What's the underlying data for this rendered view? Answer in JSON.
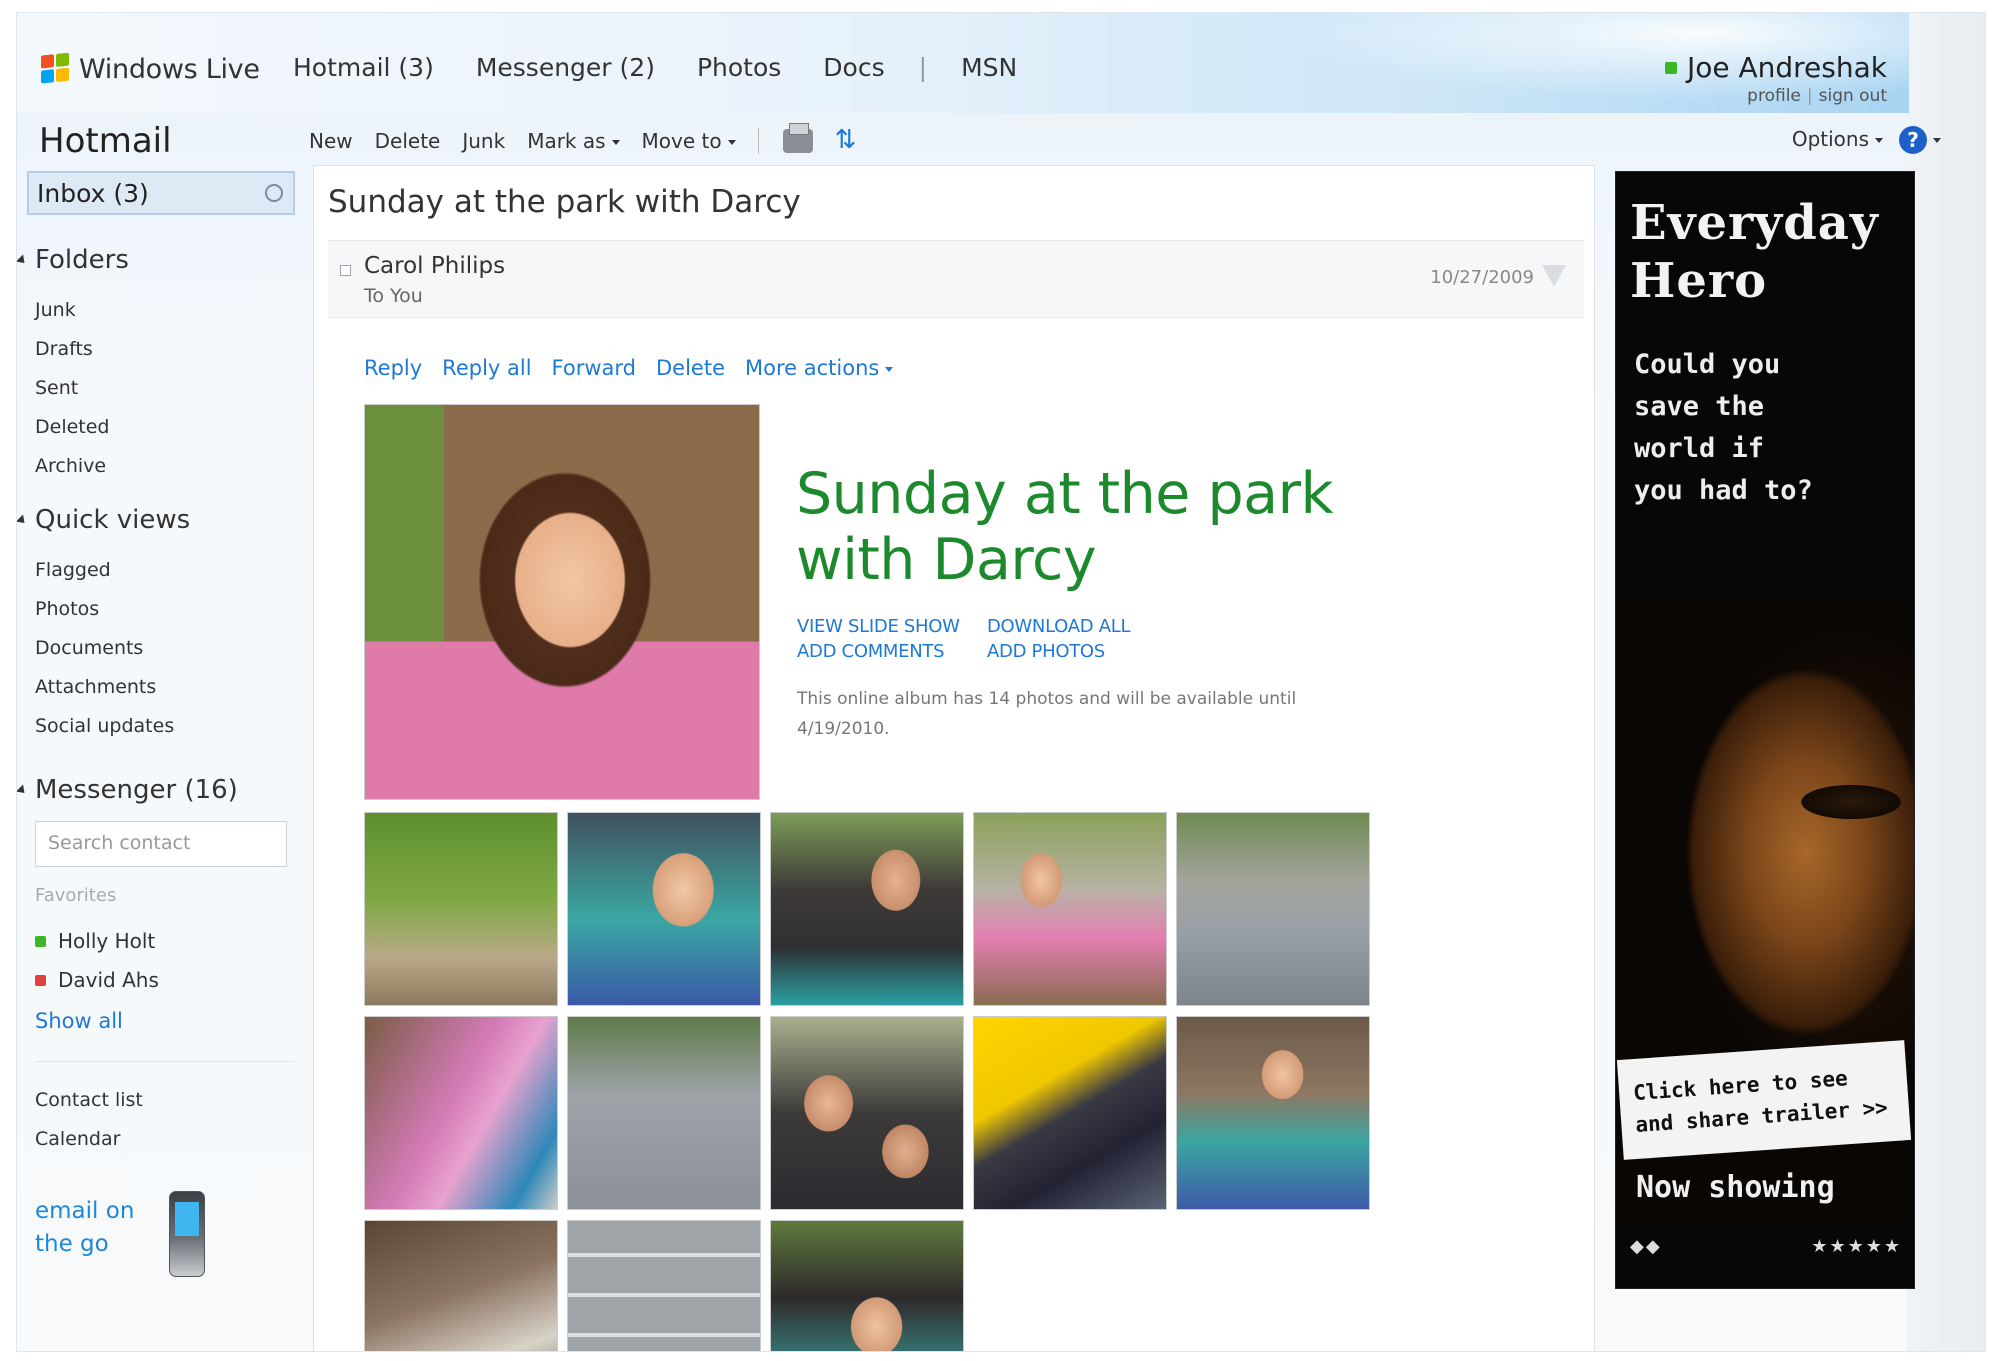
{
  "topbar": {
    "brand": "Windows Live",
    "nav": [
      "Hotmail (3)",
      "Messenger (2)",
      "Photos",
      "Docs",
      "|",
      "MSN"
    ],
    "user_name": "Joe Andreshak",
    "profile_link": "profile",
    "link_separator": "|",
    "signout_link": "sign out"
  },
  "sidebar": {
    "title": "Hotmail",
    "inbox": "Inbox (3)",
    "folders_heading": "Folders",
    "folders": [
      "Junk",
      "Drafts",
      "Sent",
      "Deleted",
      "Archive"
    ],
    "quickviews_heading": "Quick views",
    "quickviews": [
      "Flagged",
      "Photos",
      "Documents",
      "Attachments",
      "Social updates"
    ],
    "messenger_heading": "Messenger (16)",
    "search_placeholder": "Search contact",
    "favorites_label": "Favorites",
    "contacts": [
      {
        "name": "Holly Holt",
        "status_color": "#3cb528"
      },
      {
        "name": "David Ahs",
        "status_color": "#e0413a"
      }
    ],
    "show_all": "Show all",
    "bottom_links": [
      "Contact list",
      "Calendar"
    ],
    "email_go_line1": "email on",
    "email_go_line2": "the go"
  },
  "toolbar": {
    "new": "New",
    "delete": "Delete",
    "junk": "Junk",
    "mark_as": "Mark as",
    "move_to": "Move to",
    "options": "Options",
    "help": "?"
  },
  "message": {
    "subject": "Sunday at the park with Darcy",
    "sender": "Carol Philips",
    "to": "To You",
    "date": "10/27/2009",
    "actions": [
      "Reply",
      "Reply all",
      "Forward",
      "Delete",
      "More actions"
    ],
    "album_title_line1": "Sunday at the park",
    "album_title_line2": "with Darcy",
    "album_links": [
      "VIEW SLIDE SHOW",
      "DOWNLOAD ALL",
      "ADD COMMENTS",
      "ADD PHOTOS"
    ],
    "album_desc": "This online album has 14 photos and will be available until 4/19/2010."
  },
  "ad": {
    "title_line1": "Everyday",
    "title_line2": "Hero",
    "question": [
      "Could you",
      "save the",
      "world if",
      "you had to?"
    ],
    "click_line1": "Click here to see",
    "click_line2": "and share trailer >>",
    "now_showing": "Now showing",
    "stars": "★★★★★"
  },
  "colors": {
    "link_blue": "#1e78d6",
    "album_green": "#1c8a2c",
    "presence_green": "#3cb528"
  }
}
